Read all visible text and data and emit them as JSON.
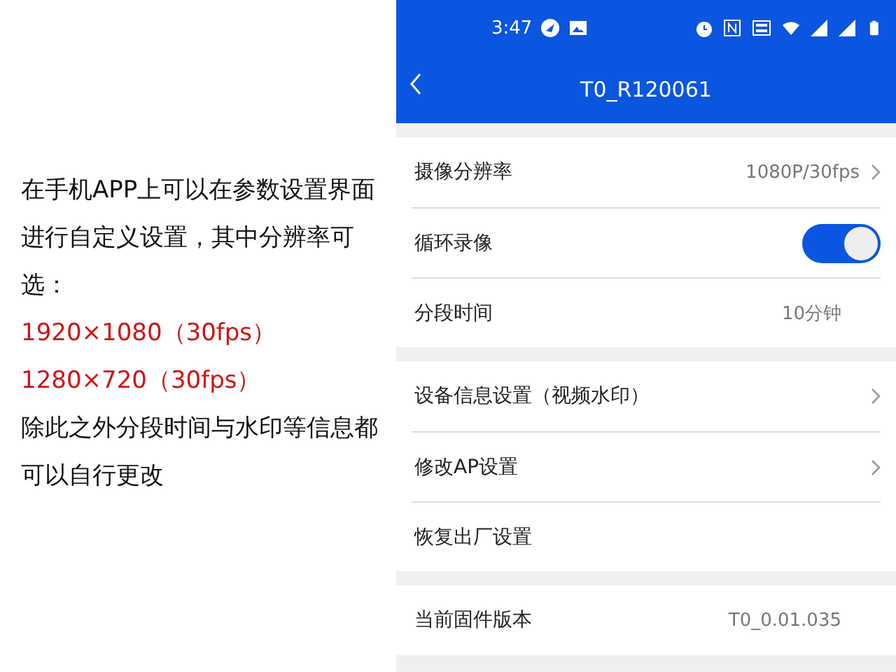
{
  "caption": [
    {
      "kind": "normal",
      "text": "在手机APP上可以在参数设置界面进行自定义设置，其中分辨率可选："
    },
    {
      "kind": "highlight",
      "text": "1920×1080（30fps）"
    },
    {
      "kind": "highlight",
      "text": "1280×720（30fps）"
    },
    {
      "kind": "normal",
      "text": "除此之外分段时间与水印等信息都可以自行更改"
    }
  ],
  "phone": {
    "status_bar": {
      "time": "3:47"
    },
    "title": "T0_R120061",
    "sections": [
      {
        "rows": [
          {
            "kind": "value-link",
            "label": "摄像分辨率",
            "value": "1080P/30fps"
          },
          {
            "kind": "toggle",
            "label": "循环录像",
            "on": true
          },
          {
            "kind": "value",
            "label": "分段时间",
            "value": "10分钟"
          }
        ]
      },
      {
        "rows": [
          {
            "kind": "link",
            "label": "设备信息设置（视频水印）"
          },
          {
            "kind": "link",
            "label": "修改AP设置"
          },
          {
            "kind": "action",
            "label": "恢复出厂设置"
          }
        ]
      },
      {
        "rows": [
          {
            "kind": "value",
            "label": "当前固件版本",
            "value": "T0_0.01.035"
          }
        ]
      }
    ]
  }
}
